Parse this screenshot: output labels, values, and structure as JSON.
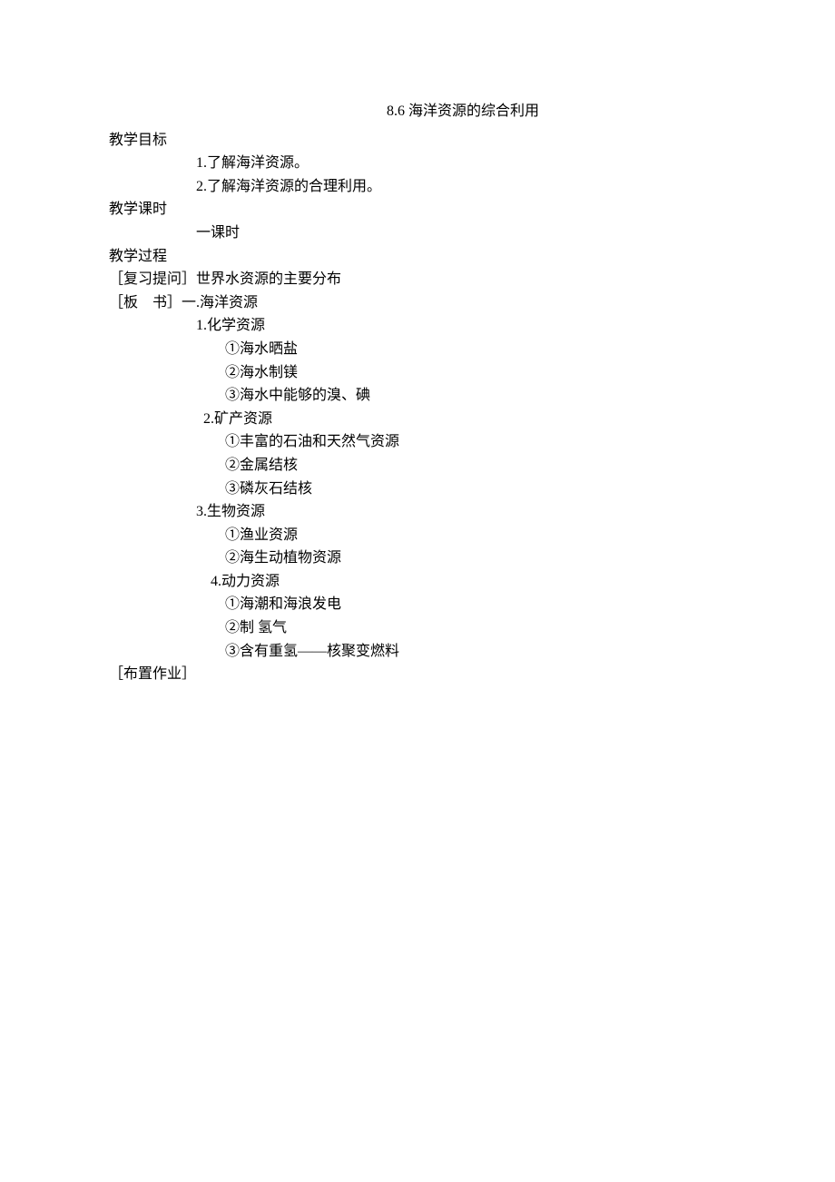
{
  "title": "8.6    海洋资源的综合利用",
  "section_objectives_label": "教学目标",
  "objectives": [
    "1.了解海洋资源。",
    "2.了解海洋资源的合理利用。"
  ],
  "section_hours_label": "教学课时",
  "hours_text": "一课时",
  "section_process_label": "教学过程",
  "review_label": "［复习提问］",
  "review_text": "世界水资源的主要分布",
  "board_label": "［板    书］",
  "board_heading": "一.海洋资源",
  "resources": [
    {
      "heading": "1.化学资源",
      "items": [
        "①海水晒盐",
        "②海水制镁",
        "③海水中能够的溴、碘"
      ]
    },
    {
      "heading": "2.矿产资源",
      "items": [
        "①丰富的石油和天然气资源",
        "②金属结核",
        "③磷灰石结核"
      ]
    },
    {
      "heading": "3.生物资源",
      "items": [
        "①渔业资源",
        "②海生动植物资源"
      ]
    },
    {
      "heading": "4.动力资源",
      "items": [
        "①海潮和海浪发电",
        "②制 氢气",
        "③含有重氢——核聚变燃料"
      ]
    }
  ],
  "homework_label": "［布置作业］"
}
